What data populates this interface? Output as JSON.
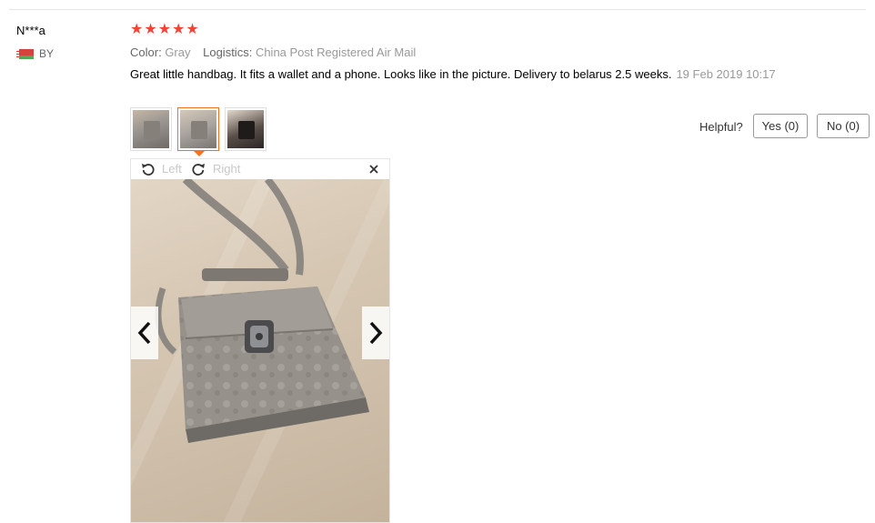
{
  "review": {
    "user_name": "N***a",
    "country": "BY",
    "rating": 5,
    "rating_stars": "★★★★★",
    "color_label": "Color:",
    "color_value": "Gray",
    "logistics_label": "Logistics:",
    "logistics_value": "China Post Registered Air Mail",
    "text": "Great little handbag. It fits a wallet and a phone. Looks like in the picture. Delivery to belarus 2.5 weeks.",
    "date": "19 Feb 2019 10:17"
  },
  "helpful": {
    "label": "Helpful?",
    "yes_label": "Yes (0)",
    "no_label": "No (0)"
  },
  "viewer": {
    "rotate_left_label": "Left",
    "rotate_right_label": "Right",
    "close_icon": "close-icon",
    "prev_icon": "chevron-left-icon",
    "next_icon": "chevron-right-icon",
    "selected_thumbnail": 2,
    "thumbnail_count": 3
  },
  "colors": {
    "star": "#f44336",
    "active_thumb_border": "#f57224",
    "muted_text": "#999999"
  }
}
